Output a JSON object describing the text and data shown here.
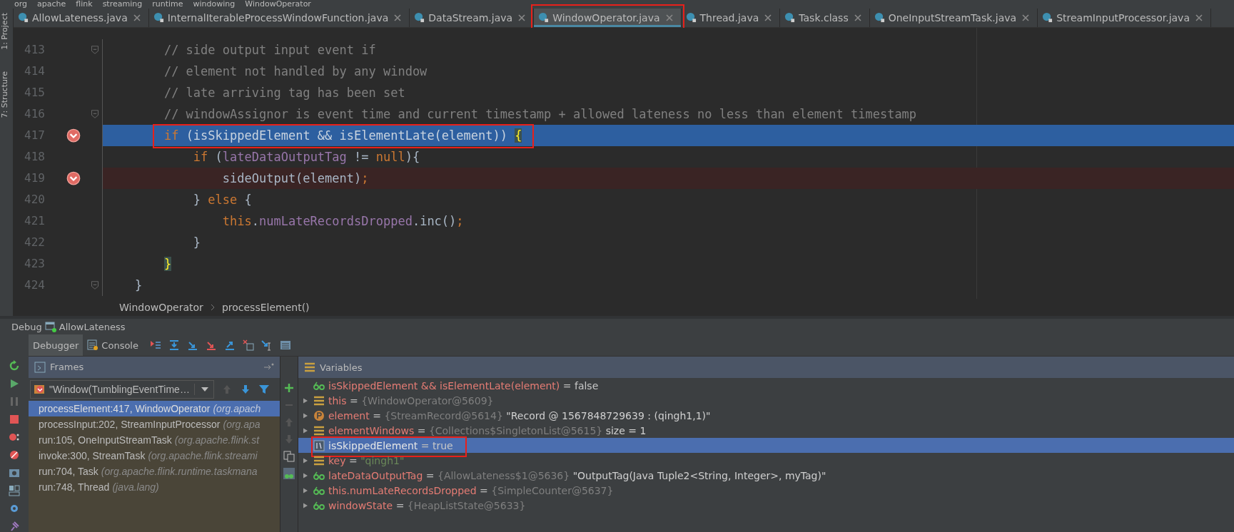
{
  "path_bar": {
    "items": [
      "org",
      "apache",
      "flink",
      "streaming",
      "runtime",
      "windowing",
      "WindowOperator"
    ]
  },
  "tool_stripe": {
    "items": [
      "1: Project",
      "7: Structure"
    ]
  },
  "tabs": [
    {
      "label": "AllowLateness.java",
      "selected": false,
      "marked": false
    },
    {
      "label": "InternalIterableProcessWindowFunction.java",
      "selected": false,
      "marked": false
    },
    {
      "label": "DataStream.java",
      "selected": false,
      "marked": false
    },
    {
      "label": "WindowOperator.java",
      "selected": true,
      "marked": true
    },
    {
      "label": "Thread.java",
      "selected": false,
      "marked": false
    },
    {
      "label": "Task.class",
      "selected": false,
      "marked": false
    },
    {
      "label": "OneInputStreamTask.java",
      "selected": false,
      "marked": false
    },
    {
      "label": "StreamInputProcessor.java",
      "selected": false,
      "marked": false
    }
  ],
  "editor": {
    "lines": [
      {
        "number": "413",
        "fold": true,
        "breakpoint": false,
        "current": false,
        "marked": false,
        "tokens": [
          {
            "t": "        // side output input event if",
            "kind": "comment"
          }
        ]
      },
      {
        "number": "414",
        "fold": false,
        "breakpoint": false,
        "current": false,
        "marked": false,
        "tokens": [
          {
            "t": "        // element not handled by any window",
            "kind": "comment"
          }
        ]
      },
      {
        "number": "415",
        "fold": false,
        "breakpoint": false,
        "current": false,
        "marked": false,
        "tokens": [
          {
            "t": "        // late arriving tag has been set",
            "kind": "comment"
          }
        ]
      },
      {
        "number": "416",
        "fold": true,
        "breakpoint": false,
        "current": false,
        "marked": false,
        "tokens": [
          {
            "t": "        // windowAssignor is event time and current timestamp + allowed lateness no less than element timestamp",
            "kind": "comment"
          }
        ]
      },
      {
        "number": "417",
        "fold": false,
        "breakpoint": true,
        "current": true,
        "marked": true,
        "tokens": [
          {
            "t": "        if",
            "kind": "keyword"
          },
          {
            "t": " (isSkippedElement && isElementLate(element)) ",
            "kind": "plain"
          },
          {
            "t": "{",
            "kind": "brace"
          }
        ]
      },
      {
        "number": "418",
        "fold": false,
        "breakpoint": false,
        "current": false,
        "marked": false,
        "tokens": [
          {
            "t": "            if",
            "kind": "keyword"
          },
          {
            "t": " (",
            "kind": "plain"
          },
          {
            "t": "lateDataOutputTag",
            "kind": "field"
          },
          {
            "t": " != ",
            "kind": "plain"
          },
          {
            "t": "null",
            "kind": "keyword"
          },
          {
            "t": "){",
            "kind": "plain"
          }
        ]
      },
      {
        "number": "419",
        "fold": false,
        "breakpoint": true,
        "current": false,
        "marked": false,
        "tokens": [
          {
            "t": "                sideOutput(element)",
            "kind": "plain"
          },
          {
            "t": ";",
            "kind": "keyword"
          }
        ]
      },
      {
        "number": "420",
        "fold": false,
        "breakpoint": false,
        "current": false,
        "marked": false,
        "tokens": [
          {
            "t": "            } ",
            "kind": "plain"
          },
          {
            "t": "else",
            "kind": "keyword"
          },
          {
            "t": " {",
            "kind": "plain"
          }
        ]
      },
      {
        "number": "421",
        "fold": false,
        "breakpoint": false,
        "current": false,
        "marked": false,
        "tokens": [
          {
            "t": "                this",
            "kind": "keyword"
          },
          {
            "t": ".",
            "kind": "plain"
          },
          {
            "t": "numLateRecordsDropped",
            "kind": "field"
          },
          {
            "t": ".inc()",
            "kind": "plain"
          },
          {
            "t": ";",
            "kind": "keyword"
          }
        ]
      },
      {
        "number": "422",
        "fold": false,
        "breakpoint": false,
        "current": false,
        "marked": false,
        "tokens": [
          {
            "t": "            }",
            "kind": "plain"
          }
        ]
      },
      {
        "number": "423",
        "fold": false,
        "breakpoint": false,
        "current": false,
        "marked": false,
        "tokens": [
          {
            "t": "        }",
            "kind": "brace"
          }
        ]
      },
      {
        "number": "424",
        "fold": true,
        "breakpoint": false,
        "current": false,
        "marked": false,
        "tokens": [
          {
            "t": "    }",
            "kind": "plain"
          }
        ]
      }
    ],
    "breadcrumbs": [
      "WindowOperator",
      "processElement()"
    ]
  },
  "debug": {
    "title": "Debug",
    "config": "AllowLateness",
    "tabs": [
      {
        "label": "Debugger",
        "selected": true
      },
      {
        "label": "Console",
        "selected": false
      }
    ],
    "frames": {
      "title": "Frames",
      "thread": "\"Window(TumblingEventTime…",
      "items": [
        {
          "location": "processElement:417, WindowOperator",
          "package": "(org.apach",
          "selected": true
        },
        {
          "location": "processInput:202, StreamInputProcessor",
          "package": "(org.apa",
          "selected": false
        },
        {
          "location": "run:105, OneInputStreamTask",
          "package": "(org.apache.flink.st",
          "selected": false
        },
        {
          "location": "invoke:300, StreamTask",
          "package": "(org.apache.flink.streami",
          "selected": false
        },
        {
          "location": "run:704, Task",
          "package": "(org.apache.flink.runtime.taskmana",
          "selected": false
        },
        {
          "location": "run:748, Thread",
          "package": "(java.lang)",
          "selected": false
        }
      ]
    },
    "variables": {
      "title": "Variables",
      "items": [
        {
          "kind": "watch",
          "expandable": false,
          "name": "isSkippedElement && isElementLate(element)",
          "separator": "=",
          "value": {
            "text": "false",
            "kind": "plain"
          },
          "selected": false,
          "marked": false
        },
        {
          "kind": "field",
          "expandable": true,
          "name": "this",
          "separator": "=",
          "value": {
            "text": "{WindowOperator@5609}",
            "kind": "ref"
          },
          "selected": false,
          "marked": false
        },
        {
          "kind": "parameter",
          "expandable": true,
          "name": "element",
          "separator": "=",
          "value": {
            "text": "{StreamRecord@5614}",
            "kind": "ref"
          },
          "detail": "\"Record @ 1567848729639 : (qingh1,1)\"",
          "selected": false,
          "marked": false
        },
        {
          "kind": "field",
          "expandable": true,
          "name": "elementWindows",
          "separator": "=",
          "value": {
            "text": "{Collections$SingletonList@5615}",
            "kind": "ref"
          },
          "detail": " size = 1",
          "selected": false,
          "marked": false
        },
        {
          "kind": "local",
          "expandable": false,
          "name": "isSkippedElement",
          "separator": "=",
          "value": {
            "text": "true",
            "kind": "plain"
          },
          "selected": true,
          "marked": true
        },
        {
          "kind": "field",
          "expandable": true,
          "name": "key",
          "separator": "=",
          "value": {
            "text": "\"qingh1\"",
            "kind": "string"
          },
          "selected": false,
          "marked": false
        },
        {
          "kind": "watch",
          "expandable": true,
          "name": "lateDataOutputTag",
          "separator": "=",
          "value": {
            "text": "{AllowLateness$1@5636}",
            "kind": "ref"
          },
          "detail": "\"OutputTag(Java Tuple2<String, Integer>, myTag)\"",
          "selected": false,
          "marked": false
        },
        {
          "kind": "watch",
          "expandable": true,
          "name": "this.numLateRecordsDropped",
          "separator": "=",
          "value": {
            "text": "{SimpleCounter@5637}",
            "kind": "ref"
          },
          "selected": false,
          "marked": false
        },
        {
          "kind": "watch",
          "expandable": true,
          "name": "windowState",
          "separator": "=",
          "value": {
            "text": "{HeapListState@5633}",
            "kind": "ref"
          },
          "selected": false,
          "marked": false
        }
      ]
    }
  }
}
